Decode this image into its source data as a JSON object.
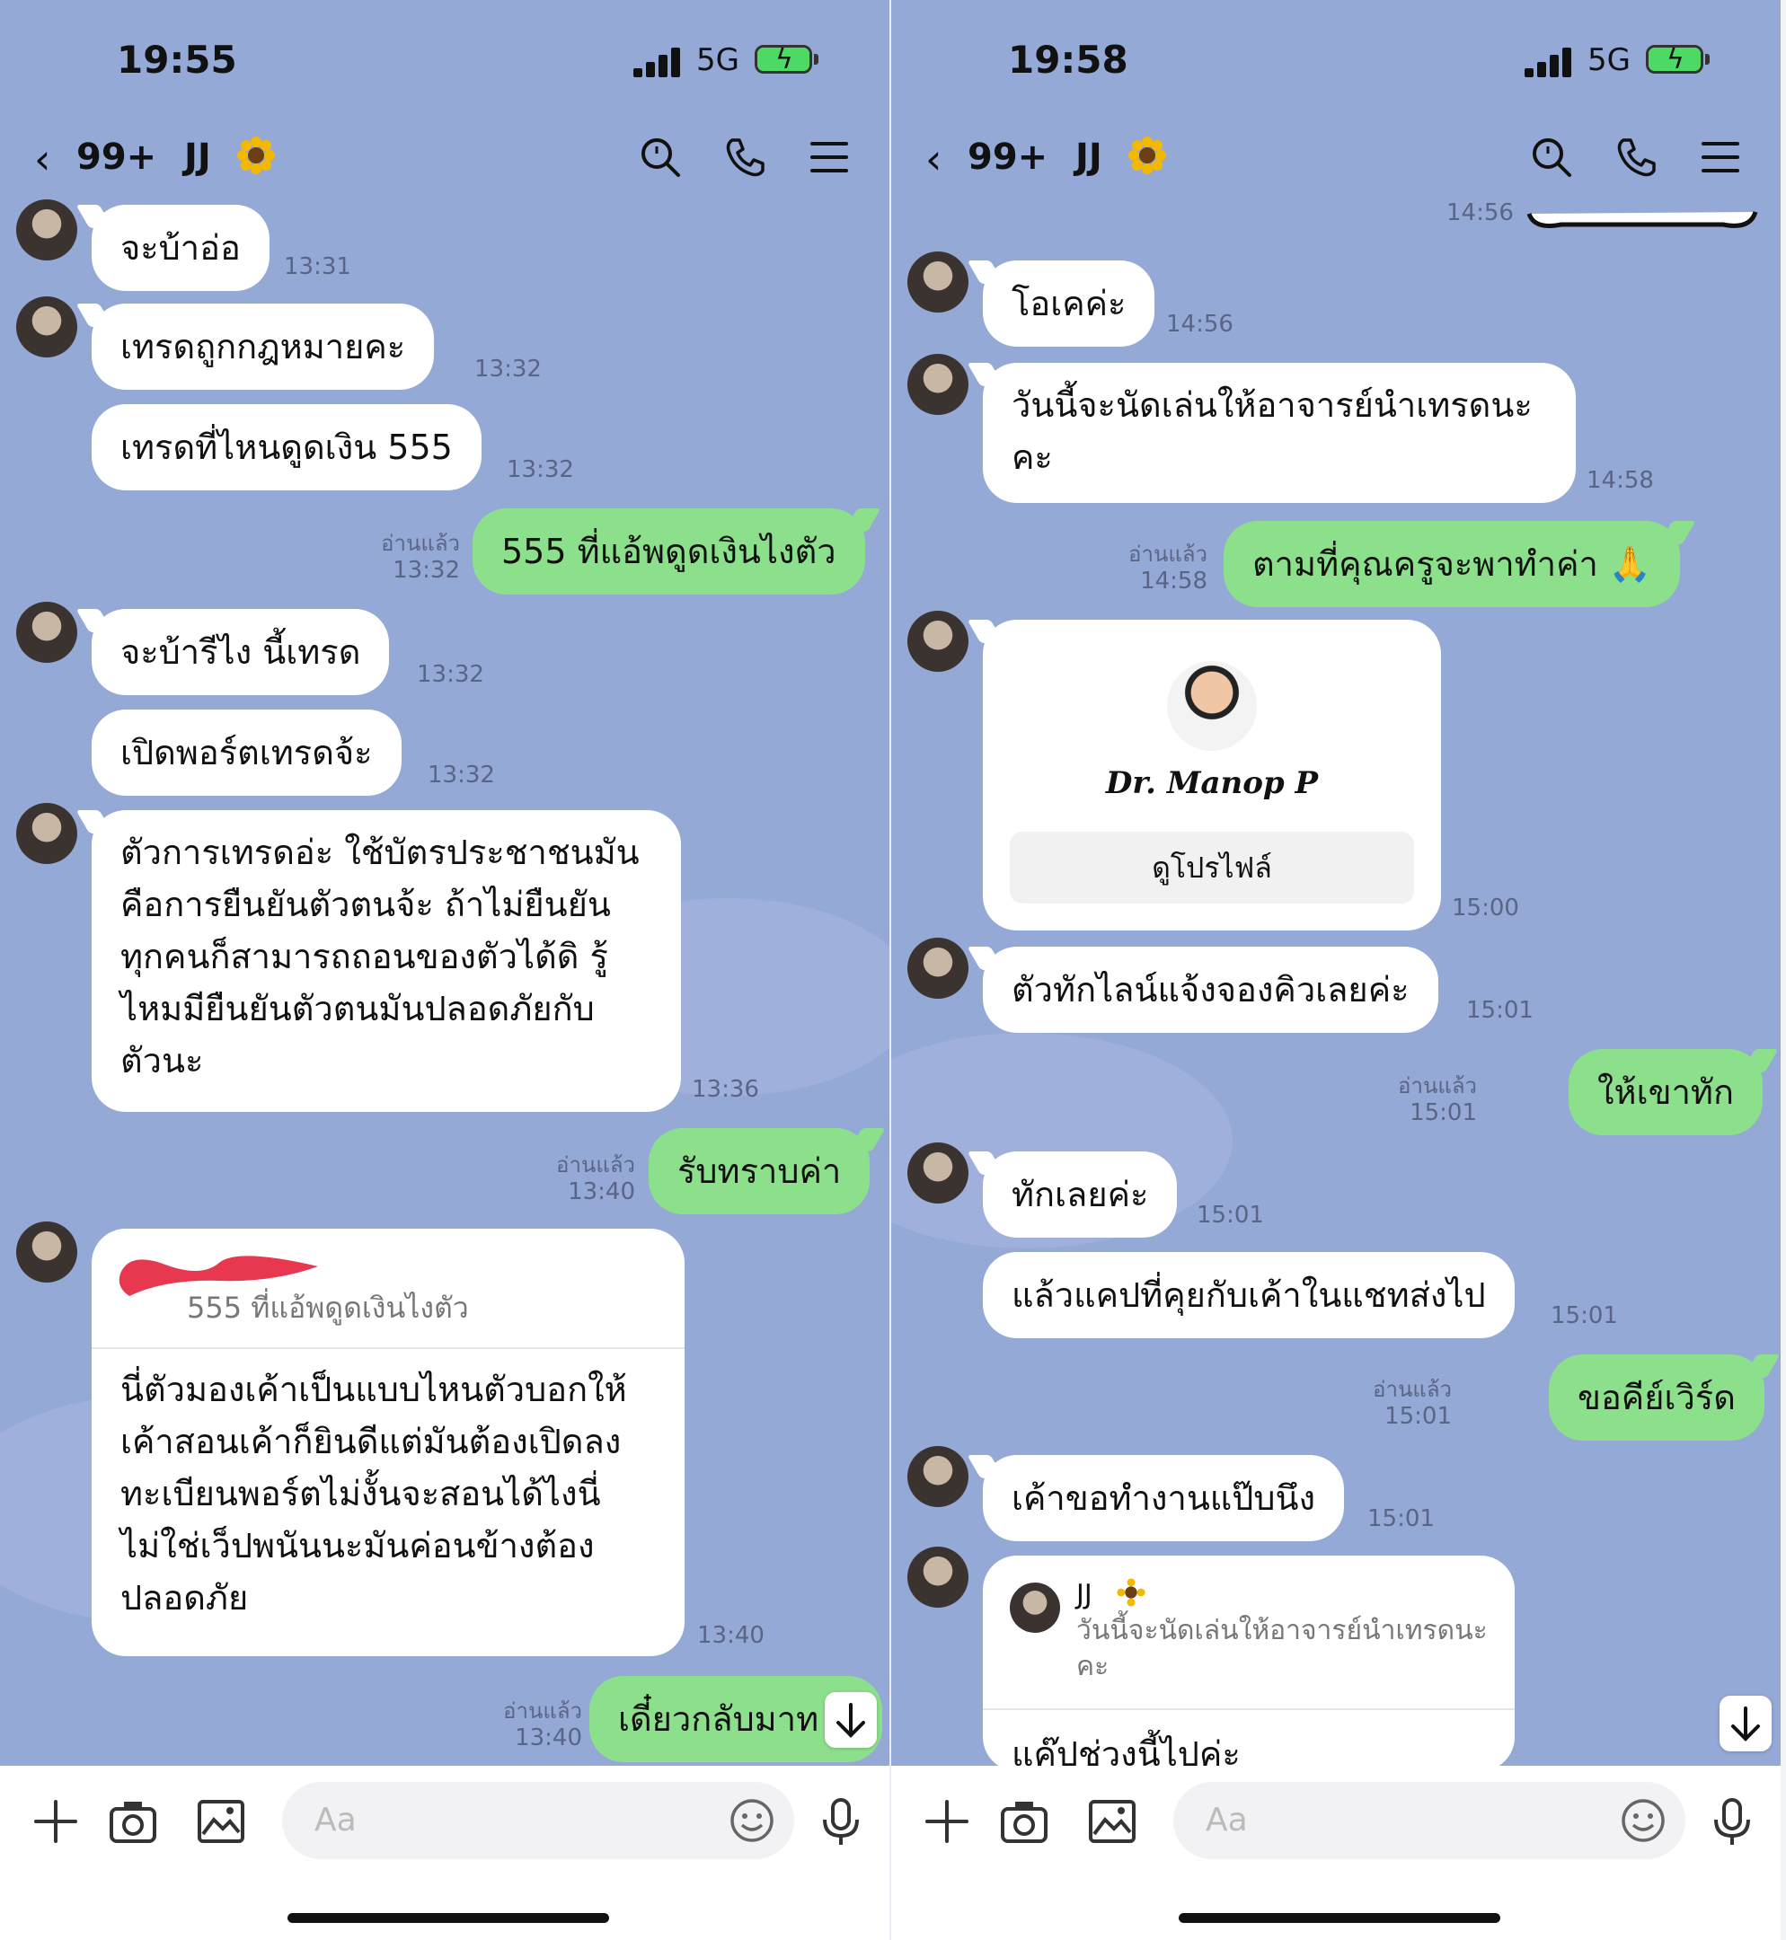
{
  "left": {
    "status": {
      "time": "19:55",
      "network": "5G"
    },
    "header": {
      "back": "‹",
      "count": "99+",
      "title": "JJ"
    },
    "messages": {
      "m1": {
        "text": "จะบ้าอ่อ",
        "time": "13:31"
      },
      "m2": {
        "text": "เทรดถูกกฎหมายคะ",
        "time": "13:32"
      },
      "m3": {
        "text": "เทรดที่ไหนดูดเงิน 555",
        "time": "13:32"
      },
      "m4": {
        "text": "555 ที่แอ้พดูดเงินไงตัว",
        "read": "อ่านแล้ว",
        "time": "13:32"
      },
      "m5": {
        "text": "จะบ้ารีไง  นี้เทรด",
        "time": "13:32"
      },
      "m6": {
        "text": "เปิดพอร์ตเทรดจ้ะ",
        "time": "13:32"
      },
      "m7": {
        "text": "ตัวการเทรดอ่ะ ใช้บัตรประชาชนมัน\nคือการยืนยันตัวตนจ้ะ  ถ้าไม่ยืนยัน\nทุกคนก็สามารถถอนของตัวได้ดิ รู้\nไหมมียืนยันตัวตนมันปลอดภัยกับ\nตัวนะ",
        "time": "13:36"
      },
      "m8": {
        "text": "รับทราบค่า",
        "read": "อ่านแล้ว",
        "time": "13:40"
      },
      "m9": {
        "quoted": "555 ที่แอ้พดูดเงินไงตัว",
        "text": "นี่ตัวมองเค้าเป็นแบบไหนตัวบอกให้\nเค้าสอนเค้าก็ยินดีแต่มันต้องเปิดลง\nทะเบียนพอร์ตไม่งั้นจะสอนได้ไงนี่\nไม่ใช่เว็ปพนันนะมันค่อนข้างต้อง\nปลอดภัย",
        "time": "13:40"
      },
      "m10": {
        "text": "เดี๋ยวกลับมาท",
        "read": "อ่านแล้ว",
        "time": "13:40"
      }
    },
    "input": {
      "placeholder": "Aa"
    }
  },
  "right": {
    "status": {
      "time": "19:58",
      "network": "5G"
    },
    "header": {
      "back": "‹",
      "count": "99+",
      "title": "JJ"
    },
    "messages": {
      "m0": {
        "time": "14:56"
      },
      "m1": {
        "text": "โอเคค่ะ",
        "time": "14:56"
      },
      "m2": {
        "text": "วันนี้จะนัดเล่นให้อาจารย์นำเทรดนะ\nคะ",
        "time": "14:58"
      },
      "m3": {
        "text": "ตามที่คุณครูจะพาทำค่า 🙏",
        "read": "อ่านแล้ว",
        "time": "14:58"
      },
      "m4": {
        "name": "Dr. Manop P",
        "button": "ดูโปรไฟล์",
        "time": "15:00"
      },
      "m5": {
        "text": "ตัวทักไลน์แจ้งจองคิวเลยค่ะ",
        "time": "15:01"
      },
      "m6": {
        "text": "ให้เขาทัก",
        "read": "อ่านแล้ว",
        "time": "15:01"
      },
      "m7": {
        "text": "ทักเลยค่ะ",
        "time": "15:01"
      },
      "m8": {
        "text": "แล้วแคปที่คุยกับเค้าในแชทส่งไป",
        "time": "15:01"
      },
      "m9": {
        "text": "ขอคีย์เวิร์ด",
        "read": "อ่านแล้ว",
        "time": "15:01"
      },
      "m10": {
        "text": "เค้าขอทำงานแป๊บนึง",
        "time": "15:01"
      },
      "m11": {
        "quoted_name": "JJ",
        "quoted": "วันนี้จะนัดเล่นให้อาจารย์นำเทรดนะ\nคะ",
        "text": "แค๊ปช่วงนี้ไปค่ะ"
      }
    },
    "input": {
      "placeholder": "Aa"
    }
  },
  "colors": {
    "chat_bg": "#94a9d6",
    "sent_bubble": "#8de08b",
    "received_bubble": "#ffffff"
  }
}
